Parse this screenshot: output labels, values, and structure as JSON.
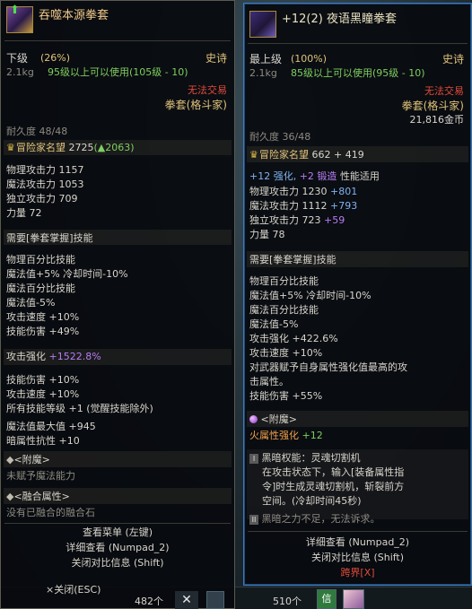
{
  "left": {
    "title": "吞噬本源拳套",
    "grade": "下级",
    "grade_pct": "(26%)",
    "rarity": "史诗",
    "weight": "2.1kg",
    "level_req": "95级以上可以使用(105级 - 10)",
    "trade": "无法交易",
    "type": "拳套(格斗家)",
    "durability": "耐久度 48/48",
    "fame_label": "冒险家名望",
    "fame_value": "2725",
    "fame_delta": "(▲2063)",
    "stats": [
      {
        "label": "物理攻击力",
        "value": "1157"
      },
      {
        "label": "魔法攻击力",
        "value": "1053"
      },
      {
        "label": "独立攻击力",
        "value": "709"
      },
      {
        "label": "力量",
        "value": "72"
      }
    ],
    "skill_req": "需要[拳套掌握]技能",
    "options": [
      "物理百分比技能",
      " 魔法值+5% 冷却时间-10%",
      "魔法百分比技能",
      " 魔法值-5%",
      "攻击速度 +10%",
      "技能伤害 +49%"
    ],
    "enhance_label": "攻击强化",
    "enhance_value": "+1522.8%",
    "extra": [
      "技能伤害 +10%",
      "攻击速度 +10%",
      "所有技能等级 +1 (觉醒技能除外)"
    ],
    "extra2": [
      "魔法值最大值 +945",
      "暗属性抗性 +10"
    ],
    "enchant_title": "<附魔>",
    "enchant_text": "未赋予魔法能力",
    "fusion_title": "<融合属性>",
    "fusion_text": "没有已融合的融合石",
    "menu1": "查看菜单 (左键)",
    "menu2": "详细查看 (Numpad_2)",
    "menu3": "关闭对比信息 (Shift)",
    "close": "×关闭(ESC)",
    "count": "482个"
  },
  "right": {
    "title": "+12(2) 夜语黑瞳拳套",
    "grade": "最上级",
    "grade_pct": "(100%)",
    "rarity": "史诗",
    "weight": "2.1kg",
    "level_req": "85级以上可以使用(95级 - 10)",
    "trade": "无法交易",
    "type": "拳套(格斗家)",
    "price": "21,816金币",
    "durability": "耐久度 36/48",
    "fame_label": "冒险家名望",
    "fame_value": "662 + 419",
    "enhance_line_a": "+12 强化,",
    "enhance_line_b": "+2 锻造",
    "enhance_line_c": "性能适用",
    "stats": [
      {
        "label": "物理攻击力",
        "value": "1230",
        "bonus": "+801"
      },
      {
        "label": "魔法攻击力",
        "value": "1112",
        "bonus": "+793"
      },
      {
        "label": "独立攻击力",
        "value": "723",
        "bonus": "+59"
      },
      {
        "label": "力量",
        "value": "78",
        "bonus": ""
      }
    ],
    "skill_req": "需要[拳套掌握]技能",
    "options": [
      "物理百分比技能",
      " 魔法值+5% 冷却时间-10%",
      "魔法百分比技能",
      " 魔法值-5%",
      "攻击强化 +422.6%",
      "攻击速度 +10%",
      "对武器赋予自身属性强化值最高的攻",
      "击属性。",
      "技能伤害 +55%"
    ],
    "enchant_title": "<附魔>",
    "enchant_stat": "火属性强化",
    "enchant_value": "+12",
    "awaken_title": "黑暗权能：灵魂切割机",
    "awaken_lines": [
      "在攻击状态下，输入[装备属性指",
      "令]时生成灵魂切割机，斩裂前方",
      "空间。(冷却时间45秒)"
    ],
    "awaken2": "黑暗之力不足，无法诉求。",
    "menu2": "详细查看 (Numpad_2)",
    "menu3": "关闭对比信息 (Shift)",
    "cross": "跨界[X]",
    "count": "510个"
  }
}
